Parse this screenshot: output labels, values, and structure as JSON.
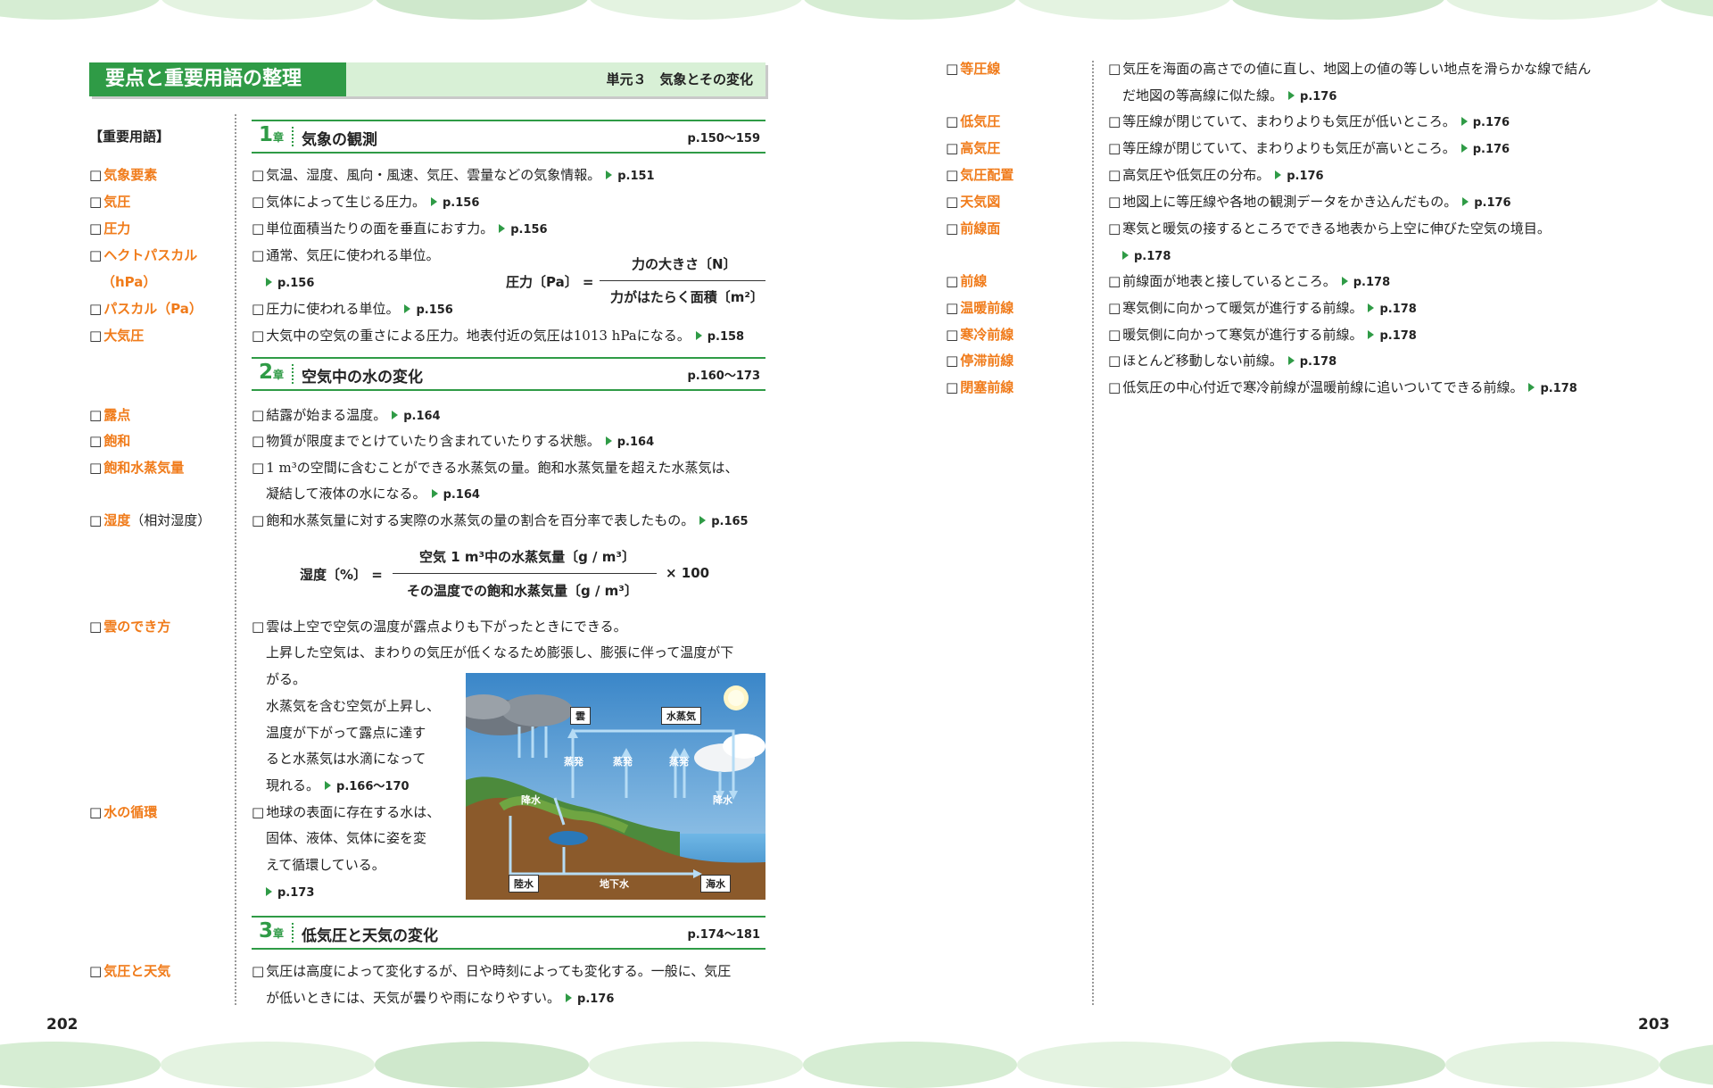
{
  "header": {
    "title": "要点と重要用語の整理",
    "unit": "単元３　気象とその変化"
  },
  "terms_heading": "【重要用語】",
  "page_left": "202",
  "page_right": "203",
  "chapters": [
    {
      "num": "1",
      "suffix": "章",
      "title": "気象の観測",
      "pages": "p.150〜159"
    },
    {
      "num": "2",
      "suffix": "章",
      "title": "空気中の水の変化",
      "pages": "p.160〜173"
    },
    {
      "num": "3",
      "suffix": "章",
      "title": "低気圧と天気の変化",
      "pages": "p.174〜181"
    }
  ],
  "left_terms": [
    {
      "term": "気象要素"
    },
    {
      "term": "気圧"
    },
    {
      "term": "圧力"
    },
    {
      "term": "ヘクトパスカル"
    },
    {
      "term": "（hPa）"
    },
    {
      "term": "パスカル（Pa）"
    },
    {
      "term": "大気圧"
    },
    {
      "term": "露点"
    },
    {
      "term": "飽和"
    },
    {
      "term": "飽和水蒸気量"
    },
    {
      "term": "湿度",
      "suffix": "（相対湿度）"
    },
    {
      "term": "雲のでき方"
    },
    {
      "term": "水の循環"
    },
    {
      "term": "気圧と天気"
    }
  ],
  "left_desc": {
    "d1": {
      "text": "気温、湿度、風向・風速、気圧、雲量などの気象情報。",
      "ref": "p.151"
    },
    "d2": {
      "text": "気体によって生じる圧力。",
      "ref": "p.156"
    },
    "d3": {
      "text": "単位面積当たりの面を垂直におす力。",
      "ref": "p.156"
    },
    "d4": {
      "text": "通常、気圧に使われる単位。",
      "ref": "p.156"
    },
    "d5": {
      "text": "圧力に使われる単位。",
      "ref": "p.156"
    },
    "d6": {
      "text": "大気中の空気の重さによる圧力。地表付近の気圧は1013 hPaになる。",
      "ref": "p.158"
    },
    "d7": {
      "text": "結露が始まる温度。",
      "ref": "p.164"
    },
    "d8": {
      "text": "物質が限度までとけていたり含まれていたりする状態。",
      "ref": "p.164"
    },
    "d9a": {
      "text": "1 m³の空間に含むことができる水蒸気の量。飽和水蒸気量を超えた水蒸気は、"
    },
    "d9b": {
      "text": "凝結して液体の水になる。",
      "ref": "p.164"
    },
    "d10": {
      "text": "飽和水蒸気量に対する実際の水蒸気の量の割合を百分率で表したもの。",
      "ref": "p.165"
    },
    "d11": {
      "text": "雲は上空で空気の温度が露点よりも下がったときにできる。"
    },
    "d11b": {
      "text": "上昇した空気は、まわりの気圧が低くなるため膨張し、膨張に伴って温度が下"
    },
    "d11c": {
      "text": "がる。"
    },
    "d11d": {
      "text": "水蒸気を含む空気が上昇し、"
    },
    "d11e": {
      "text": "温度が下がって露点に達す"
    },
    "d11f": {
      "text": "ると水蒸気は水滴になって"
    },
    "d11g": {
      "text": "現れる。",
      "ref": "p.166〜170"
    },
    "d12a": {
      "text": "地球の表面に存在する水は、"
    },
    "d12b": {
      "text": "固体、液体、気体に姿を変"
    },
    "d12c": {
      "text": "えて循環している。"
    },
    "d12d": {
      "ref": "p.173"
    },
    "d13a": {
      "text": "気圧は高度によって変化するが、日や時刻によっても変化する。一般に、気圧"
    },
    "d13b": {
      "text": "が低いときには、天気が曇りや雨になりやすい。",
      "ref": "p.176"
    }
  },
  "formula1": {
    "left": "圧力〔Pa〕 =",
    "num": "力の大きさ〔N〕",
    "den": "力がはたらく面積〔m²〕"
  },
  "formula2": {
    "left": "湿度〔%〕 =",
    "num": "空気 1 m³中の水蒸気量〔g / m³〕",
    "den": "その温度での飽和水蒸気量〔g / m³〕",
    "right": "× 100"
  },
  "diagram": {
    "cloud": "雲",
    "vapor": "水蒸気",
    "evap": "蒸発",
    "rain": "降水",
    "land": "陸水",
    "ground": "地下水",
    "sea": "海水"
  },
  "right_terms": [
    {
      "term": "等圧線"
    },
    {
      "term": "低気圧"
    },
    {
      "term": "高気圧"
    },
    {
      "term": "気圧配置"
    },
    {
      "term": "天気図"
    },
    {
      "term": "前線面"
    },
    {
      "term": "前線"
    },
    {
      "term": "温暖前線"
    },
    {
      "term": "寒冷前線"
    },
    {
      "term": "停滞前線"
    },
    {
      "term": "閉塞前線"
    }
  ],
  "right_desc": {
    "r1a": {
      "text": "気圧を海面の高さでの値に直し、地図上の値の等しい地点を滑らかな線で結ん"
    },
    "r1b": {
      "text": "だ地図の等高線に似た線。",
      "ref": "p.176"
    },
    "r2": {
      "text": "等圧線が閉じていて、まわりよりも気圧が低いところ。",
      "ref": "p.176"
    },
    "r3": {
      "text": "等圧線が閉じていて、まわりよりも気圧が高いところ。",
      "ref": "p.176"
    },
    "r4": {
      "text": "高気圧や低気圧の分布。",
      "ref": "p.176"
    },
    "r5": {
      "text": "地図上に等圧線や各地の観測データをかき込んだもの。",
      "ref": "p.176"
    },
    "r6a": {
      "text": "寒気と暖気の接するところでできる地表から上空に伸びた空気の境目。"
    },
    "r6b": {
      "ref": "p.178"
    },
    "r7": {
      "text": "前線面が地表と接しているところ。",
      "ref": "p.178"
    },
    "r8": {
      "text": "寒気側に向かって暖気が進行する前線。",
      "ref": "p.178"
    },
    "r9": {
      "text": "暖気側に向かって寒気が進行する前線。",
      "ref": "p.178"
    },
    "r10": {
      "text": "ほとんど移動しない前線。",
      "ref": "p.178"
    },
    "r11": {
      "text": "低気圧の中心付近で寒冷前線が温暖前線に追いついてできる前線。",
      "ref": "p.178"
    }
  },
  "colors": {
    "accent_green": "#2f9b46",
    "term_orange": "#f07b1a",
    "header_bg": "#d8f0d6"
  }
}
